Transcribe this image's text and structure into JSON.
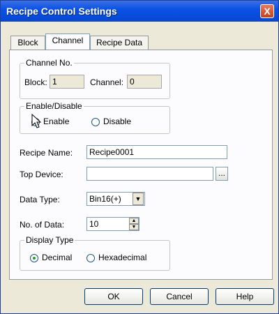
{
  "window": {
    "title": "Recipe Control Settings",
    "close_glyph": "X"
  },
  "tabs": [
    {
      "label": "Block"
    },
    {
      "label": "Channel"
    },
    {
      "label": "Recipe Data"
    }
  ],
  "channel_no": {
    "group_label": "Channel No.",
    "block_label": "Block:",
    "block_value": "1",
    "channel_label": "Channel:",
    "channel_value": "0"
  },
  "enable_disable": {
    "group_label": "Enable/Disable",
    "enable_label": "Enable",
    "disable_label": "Disable",
    "selected": "Enable"
  },
  "recipe_name": {
    "label": "Recipe Name:",
    "value": "Recipe0001"
  },
  "top_device": {
    "label": "Top Device:",
    "value": "",
    "browse_label": "..."
  },
  "data_type": {
    "label": "Data Type:",
    "value": "Bin16(+)"
  },
  "no_of_data": {
    "label": "No. of Data:",
    "value": "10"
  },
  "display_type": {
    "group_label": "Display Type",
    "decimal_label": "Decimal",
    "hex_label": "Hexadecimal",
    "selected": "Decimal"
  },
  "buttons": {
    "ok": "OK",
    "cancel": "Cancel",
    "help": "Help"
  },
  "colors": {
    "titlebar": "#0a53e6",
    "dialog_bg": "#ece9d8",
    "close": "#c4401e"
  },
  "icons": [
    "close-icon",
    "mouse-cursor-icon",
    "dropdown-arrow-icon",
    "spin-up-icon",
    "spin-down-icon"
  ]
}
